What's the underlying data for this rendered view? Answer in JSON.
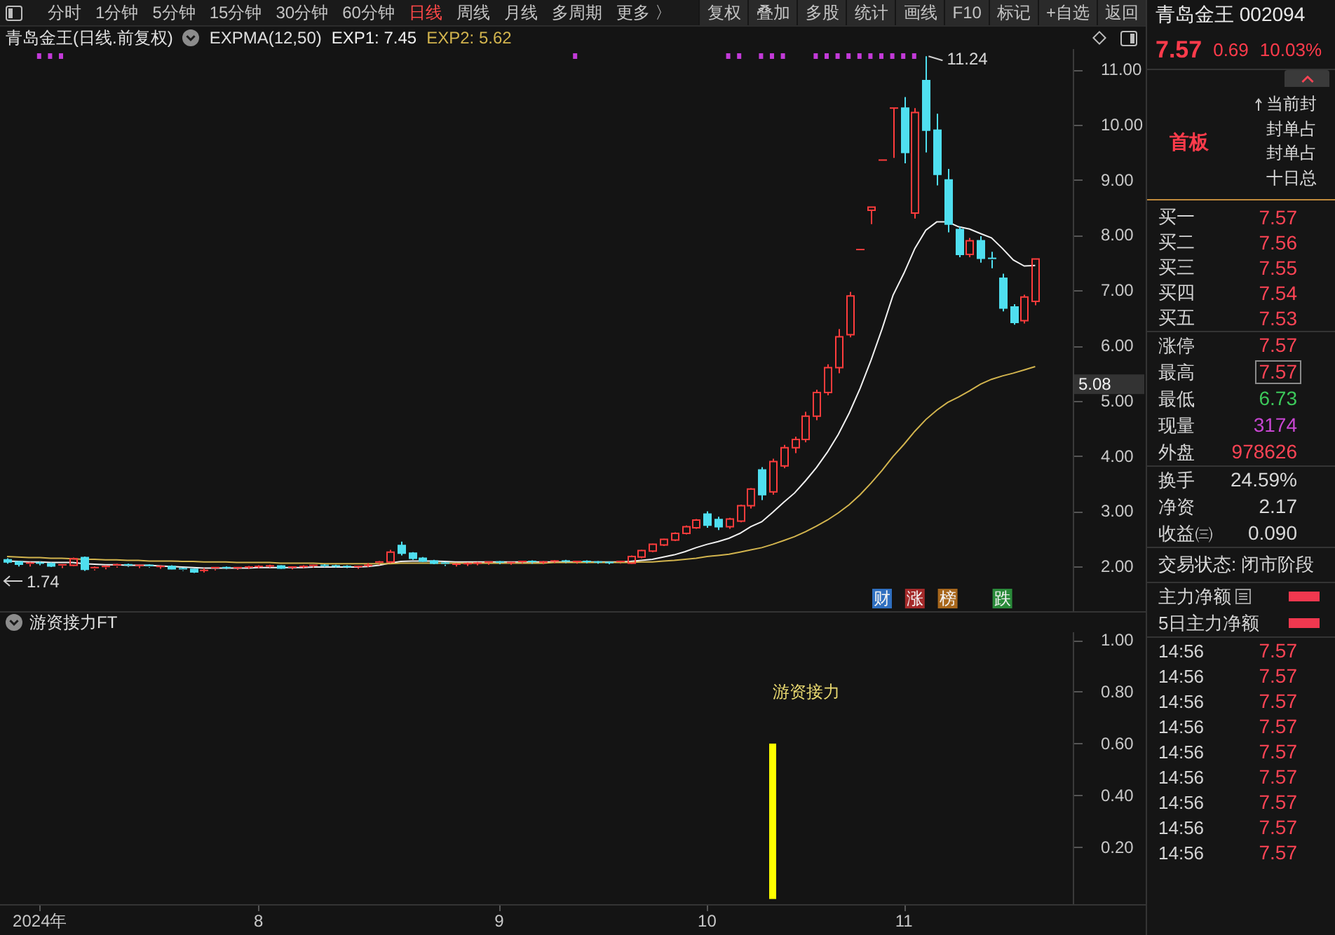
{
  "toolbar": {
    "period_tabs": [
      {
        "label": "分时",
        "selected": false
      },
      {
        "label": "1分钟",
        "selected": false
      },
      {
        "label": "5分钟",
        "selected": false
      },
      {
        "label": "15分钟",
        "selected": false
      },
      {
        "label": "30分钟",
        "selected": false
      },
      {
        "label": "60分钟",
        "selected": false
      },
      {
        "label": "日线",
        "selected": true
      },
      {
        "label": "周线",
        "selected": false
      },
      {
        "label": "月线",
        "selected": false
      },
      {
        "label": "多周期",
        "selected": false
      },
      {
        "label": "更多 〉",
        "selected": false
      }
    ],
    "tool_buttons": [
      "复权",
      "叠加",
      "多股",
      "统计",
      "画线",
      "F10",
      "标记",
      "+自选",
      "返回"
    ]
  },
  "price_chart": {
    "title": "青岛金王(日线.前复权)",
    "indicator_name": "EXPMA(12,50)",
    "high_label": "11.24",
    "low_label": "1.74",
    "price_tag": "5.08",
    "event_tags": [
      {
        "label": "财",
        "color": "#2f6fc0"
      },
      {
        "label": "涨",
        "color": "#a42a2a"
      },
      {
        "label": "榜",
        "color": "#a8671c"
      },
      {
        "label": "跌",
        "color": "#2a8a3a"
      }
    ],
    "chart_data": {
      "type": "line",
      "ylim": [
        1.19,
        11.37
      ],
      "categories": [
        null,
        null,
        null,
        null,
        null,
        null,
        null,
        null,
        null,
        null,
        null,
        null,
        null,
        null,
        null,
        null,
        null,
        null,
        null,
        null,
        null,
        null,
        null,
        null,
        null,
        null,
        null,
        null,
        null,
        null,
        null,
        null,
        null,
        null,
        null,
        null,
        null,
        null,
        null,
        null,
        null,
        null,
        null,
        null,
        null,
        null,
        null,
        null,
        null,
        null,
        null,
        null,
        null,
        null,
        null,
        null,
        null,
        null,
        null,
        null,
        null,
        null,
        null,
        null,
        null,
        null,
        null,
        null,
        null,
        null,
        null,
        null,
        null,
        null,
        null,
        null,
        null,
        null,
        null,
        null,
        null,
        null,
        null,
        null,
        null,
        null,
        null,
        null,
        null,
        null,
        null,
        null,
        null,
        null,
        null
      ],
      "yticks": [
        {
          "value": 11,
          "label": "11.00"
        },
        {
          "value": 10,
          "label": "10.00"
        },
        {
          "value": 9,
          "label": "9.00"
        },
        {
          "value": 8,
          "label": "8.00"
        },
        {
          "value": 7,
          "label": "7.00"
        },
        {
          "value": 6,
          "label": "6.00"
        },
        {
          "value": 5,
          "label": "5.00"
        },
        {
          "value": 4,
          "label": "4.00"
        },
        {
          "value": 3,
          "label": "3.00"
        },
        {
          "value": 2,
          "label": "2.00"
        }
      ],
      "series": [
        {
          "name": "EXP1: 7.45",
          "color": "#f0f0f0",
          "values": [
            2.1,
            2.09,
            2.08,
            2.08,
            2.07,
            2.07,
            2.07,
            2.05,
            2.04,
            2.03,
            2.03,
            2.02,
            2.02,
            2.02,
            2.01,
            2.0,
            1.99,
            1.98,
            1.97,
            1.97,
            1.97,
            1.97,
            1.97,
            1.98,
            1.98,
            1.98,
            1.98,
            1.98,
            1.99,
            1.99,
            1.99,
            1.99,
            1.99,
            2.0,
            2.02,
            2.06,
            2.09,
            2.1,
            2.1,
            2.1,
            2.09,
            2.08,
            2.08,
            2.08,
            2.08,
            2.08,
            2.08,
            2.08,
            2.08,
            2.08,
            2.08,
            2.08,
            2.08,
            2.08,
            2.08,
            2.08,
            2.08,
            2.09,
            2.11,
            2.13,
            2.17,
            2.21,
            2.27,
            2.34,
            2.4,
            2.45,
            2.51,
            2.6,
            2.72,
            2.81,
            2.98,
            3.16,
            3.33,
            3.55,
            3.79,
            4.07,
            4.39,
            4.78,
            5.23,
            5.74,
            6.3,
            6.91,
            7.31,
            7.76,
            8.09,
            8.24,
            8.24,
            8.15,
            8.11,
            8.03,
            7.95,
            7.76,
            7.55,
            7.44,
            7.45
          ]
        },
        {
          "name": "EXP2: 5.62",
          "color": "#d2b44e",
          "values": [
            2.18,
            2.17,
            2.16,
            2.16,
            2.15,
            2.15,
            2.14,
            2.13,
            2.13,
            2.12,
            2.12,
            2.11,
            2.11,
            2.1,
            2.1,
            2.1,
            2.09,
            2.09,
            2.08,
            2.08,
            2.08,
            2.07,
            2.07,
            2.07,
            2.07,
            2.06,
            2.06,
            2.06,
            2.06,
            2.05,
            2.05,
            2.05,
            2.05,
            2.05,
            2.05,
            2.05,
            2.06,
            2.06,
            2.06,
            2.06,
            2.06,
            2.06,
            2.06,
            2.06,
            2.06,
            2.06,
            2.06,
            2.06,
            2.06,
            2.06,
            2.07,
            2.07,
            2.07,
            2.07,
            2.07,
            2.07,
            2.07,
            2.07,
            2.08,
            2.08,
            2.1,
            2.11,
            2.13,
            2.15,
            2.18,
            2.2,
            2.22,
            2.26,
            2.3,
            2.34,
            2.4,
            2.47,
            2.54,
            2.63,
            2.73,
            2.84,
            2.97,
            3.12,
            3.3,
            3.51,
            3.74,
            3.99,
            4.21,
            4.45,
            4.66,
            4.83,
            4.97,
            5.07,
            5.18,
            5.3,
            5.39,
            5.45,
            5.5,
            5.56,
            5.62
          ]
        }
      ]
    }
  },
  "indicator_chart": {
    "title": "游资接力FT",
    "bar_label": "游资接力",
    "chart_data": {
      "type": "bar",
      "ylim": [
        -0.02,
        1.03
      ],
      "categories": [
        null,
        null,
        null,
        "2024年",
        null,
        null,
        null,
        null,
        null,
        null,
        null,
        null,
        null,
        null,
        null,
        null,
        null,
        null,
        null,
        null,
        null,
        null,
        null,
        "8",
        null,
        null,
        null,
        null,
        null,
        null,
        null,
        null,
        null,
        null,
        null,
        null,
        null,
        null,
        null,
        null,
        null,
        null,
        null,
        null,
        null,
        "9",
        null,
        null,
        null,
        null,
        null,
        null,
        null,
        null,
        null,
        null,
        null,
        null,
        null,
        null,
        null,
        null,
        null,
        null,
        "10",
        null,
        null,
        null,
        null,
        null,
        null,
        null,
        null,
        null,
        null,
        null,
        null,
        null,
        null,
        null,
        null,
        null,
        "11",
        null,
        null,
        null,
        null,
        null,
        null,
        null,
        null,
        null,
        null,
        null,
        null
      ],
      "yticks": [
        {
          "value": 1,
          "label": "1.00"
        },
        {
          "value": 0.8,
          "label": "0.80"
        },
        {
          "value": 0.6,
          "label": "0.60"
        },
        {
          "value": 0.4,
          "label": "0.40"
        },
        {
          "value": 0.2,
          "label": "0.20"
        }
      ],
      "series": [
        {
          "color": "#ffff00",
          "values": [
            null,
            null,
            null,
            null,
            null,
            null,
            null,
            null,
            null,
            null,
            null,
            null,
            null,
            null,
            null,
            null,
            null,
            null,
            null,
            null,
            null,
            null,
            null,
            null,
            null,
            null,
            null,
            null,
            null,
            null,
            null,
            null,
            null,
            null,
            null,
            null,
            null,
            null,
            null,
            null,
            null,
            null,
            null,
            null,
            null,
            null,
            null,
            null,
            null,
            null,
            null,
            null,
            null,
            null,
            null,
            null,
            null,
            null,
            null,
            null,
            null,
            null,
            null,
            null,
            null,
            null,
            null,
            null,
            null,
            null,
            0.6,
            null,
            null,
            null,
            null,
            null,
            null,
            null,
            null,
            null,
            null,
            null,
            null,
            null,
            null,
            null,
            null,
            null,
            null,
            null,
            null,
            null,
            null,
            null,
            null
          ]
        }
      ]
    }
  },
  "quote_panel": {
    "name": "青岛金王 002094",
    "price": "7.57",
    "change": "0.69",
    "change_pct": "10.03%",
    "board": "首板",
    "seal_info": [
      {
        "label": "当前封",
        "icon": true
      },
      {
        "label": "封单占",
        "icon": false
      },
      {
        "label": "封单占",
        "icon": false
      },
      {
        "label": "十日总",
        "icon": false
      }
    ],
    "bids": [
      {
        "label": "买一",
        "value": "7.57"
      },
      {
        "label": "买二",
        "value": "7.56"
      },
      {
        "label": "买三",
        "value": "7.55"
      },
      {
        "label": "买四",
        "value": "7.54"
      },
      {
        "label": "买五",
        "value": "7.53"
      }
    ],
    "stats": [
      {
        "label": "涨停",
        "value": "7.57",
        "color": "#ff4455",
        "highlighted": false
      },
      {
        "label": "最高",
        "value": "7.57",
        "color": "#ff4455",
        "highlighted": true
      },
      {
        "label": "最低",
        "value": "6.73",
        "color": "#3cc85a",
        "highlighted": false
      },
      {
        "label": "现量",
        "value": "3174",
        "color": "#c846d2",
        "highlighted": false
      },
      {
        "label": "外盘",
        "value": "978626",
        "color": "#ff4455",
        "highlighted": false
      }
    ],
    "fundamentals": [
      {
        "label": "换手",
        "value": "24.59%"
      },
      {
        "label": "净资",
        "value": "2.17"
      },
      {
        "label": "收益㈢",
        "value": "0.090"
      }
    ],
    "trade_status": "交易状态: 闭市阶段",
    "fund_flow": [
      {
        "label": "主力净额",
        "info_icon": true,
        "color": "#f0384f"
      },
      {
        "label": "5日主力净额",
        "info_icon": false,
        "color": "#f0384f"
      }
    ],
    "ticks": [
      {
        "time": "14:56",
        "price": "7.57"
      },
      {
        "time": "14:56",
        "price": "7.57"
      },
      {
        "time": "14:56",
        "price": "7.57"
      },
      {
        "time": "14:56",
        "price": "7.57"
      },
      {
        "time": "14:56",
        "price": "7.57"
      },
      {
        "time": "14:56",
        "price": "7.57"
      },
      {
        "time": "14:56",
        "price": "7.57"
      },
      {
        "time": "14:56",
        "price": "7.57"
      },
      {
        "time": "14:56",
        "price": "7.57"
      }
    ]
  }
}
